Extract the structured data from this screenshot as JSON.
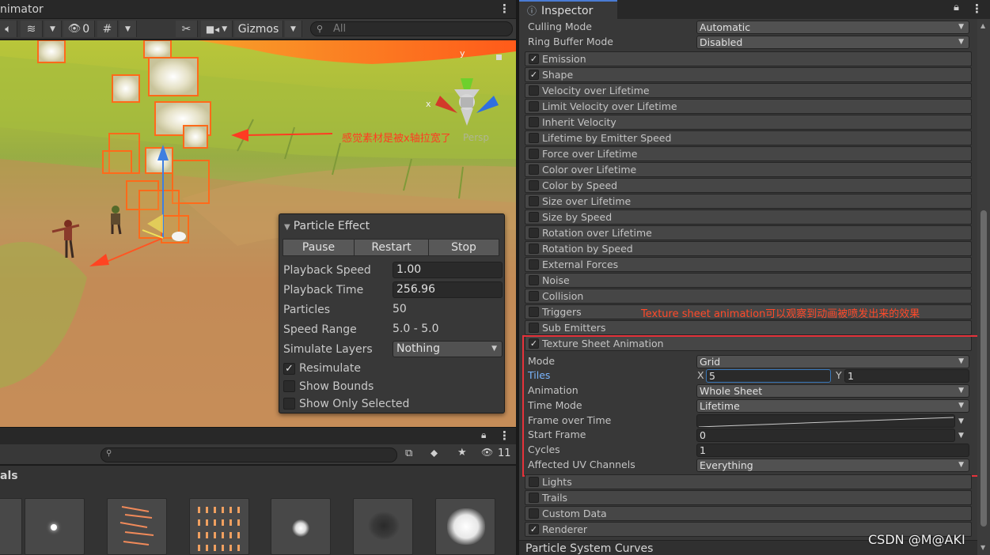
{
  "scene": {
    "tab_label": "nimator",
    "toolbar": {
      "hidden_count": "0",
      "gizmos_label": "Gizmos",
      "search_placeholder": "All"
    },
    "annotation": "感觉素材是被x轴拉宽了",
    "annotation_ghost": "Persp",
    "gizmo_axes": {
      "x": "x",
      "y": "y"
    }
  },
  "particle_effect": {
    "title": "Particle Effect",
    "buttons": [
      "Pause",
      "Restart",
      "Stop"
    ],
    "rows": {
      "playback_speed_label": "Playback Speed",
      "playback_speed_value": "1.00",
      "playback_time_label": "Playback Time",
      "playback_time_value": "256.96",
      "particles_label": "Particles",
      "particles_value": "50",
      "speed_range_label": "Speed Range",
      "speed_range_value": "5.0 - 5.0",
      "simulate_layers_label": "Simulate Layers",
      "simulate_layers_value": "Nothing"
    },
    "checks": [
      {
        "label": "Resimulate",
        "checked": true
      },
      {
        "label": "Show Bounds",
        "checked": false
      },
      {
        "label": "Show Only Selected",
        "checked": false
      }
    ]
  },
  "project": {
    "hidden_count": "11",
    "folder_label": "als"
  },
  "inspector": {
    "tab_label": "Inspector",
    "top_props": [
      {
        "label": "Culling Mode",
        "value": "Automatic"
      },
      {
        "label": "Ring Buffer Mode",
        "value": "Disabled"
      }
    ],
    "modules": [
      {
        "label": "Emission",
        "checked": true
      },
      {
        "label": "Shape",
        "checked": true
      },
      {
        "label": "Velocity over Lifetime",
        "checked": false
      },
      {
        "label": "Limit Velocity over Lifetime",
        "checked": false
      },
      {
        "label": "Inherit Velocity",
        "checked": false
      },
      {
        "label": "Lifetime by Emitter Speed",
        "checked": false
      },
      {
        "label": "Force over Lifetime",
        "checked": false
      },
      {
        "label": "Color over Lifetime",
        "checked": false
      },
      {
        "label": "Color by Speed",
        "checked": false
      },
      {
        "label": "Size over Lifetime",
        "checked": false
      },
      {
        "label": "Size by Speed",
        "checked": false
      },
      {
        "label": "Rotation over Lifetime",
        "checked": false
      },
      {
        "label": "Rotation by Speed",
        "checked": false
      },
      {
        "label": "External Forces",
        "checked": false
      },
      {
        "label": "Noise",
        "checked": false
      },
      {
        "label": "Collision",
        "checked": false
      },
      {
        "label": "Triggers",
        "checked": false
      },
      {
        "label": "Sub Emitters",
        "checked": false
      }
    ],
    "tsa_annotation": "Texture sheet animation可以观察到动画被喷发出来的效果",
    "tsa": {
      "title": "Texture Sheet Animation",
      "checked": true,
      "mode_label": "Mode",
      "mode_value": "Grid",
      "tiles_label": "Tiles",
      "tiles_x_label": "X",
      "tiles_x": "5",
      "tiles_y_label": "Y",
      "tiles_y": "1",
      "animation_label": "Animation",
      "animation_value": "Whole Sheet",
      "time_mode_label": "Time Mode",
      "time_mode_value": "Lifetime",
      "frame_over_time_label": "Frame over Time",
      "start_frame_label": "Start Frame",
      "start_frame_value": "0",
      "cycles_label": "Cycles",
      "cycles_value": "1",
      "uv_label": "Affected UV Channels",
      "uv_value": "Everything"
    },
    "bottom_modules": [
      {
        "label": "Lights",
        "checked": false
      },
      {
        "label": "Trails",
        "checked": false
      },
      {
        "label": "Custom Data",
        "checked": false
      },
      {
        "label": "Renderer",
        "checked": true
      }
    ],
    "curves_label": "Particle System Curves"
  },
  "watermark": "CSDN @M@AKI",
  "colors": {
    "annotation_red": "#ff3b22",
    "highlight_box": "#e5323a",
    "tab_accent": "#4a7bd4",
    "label_blue": "#7ab6ff"
  }
}
